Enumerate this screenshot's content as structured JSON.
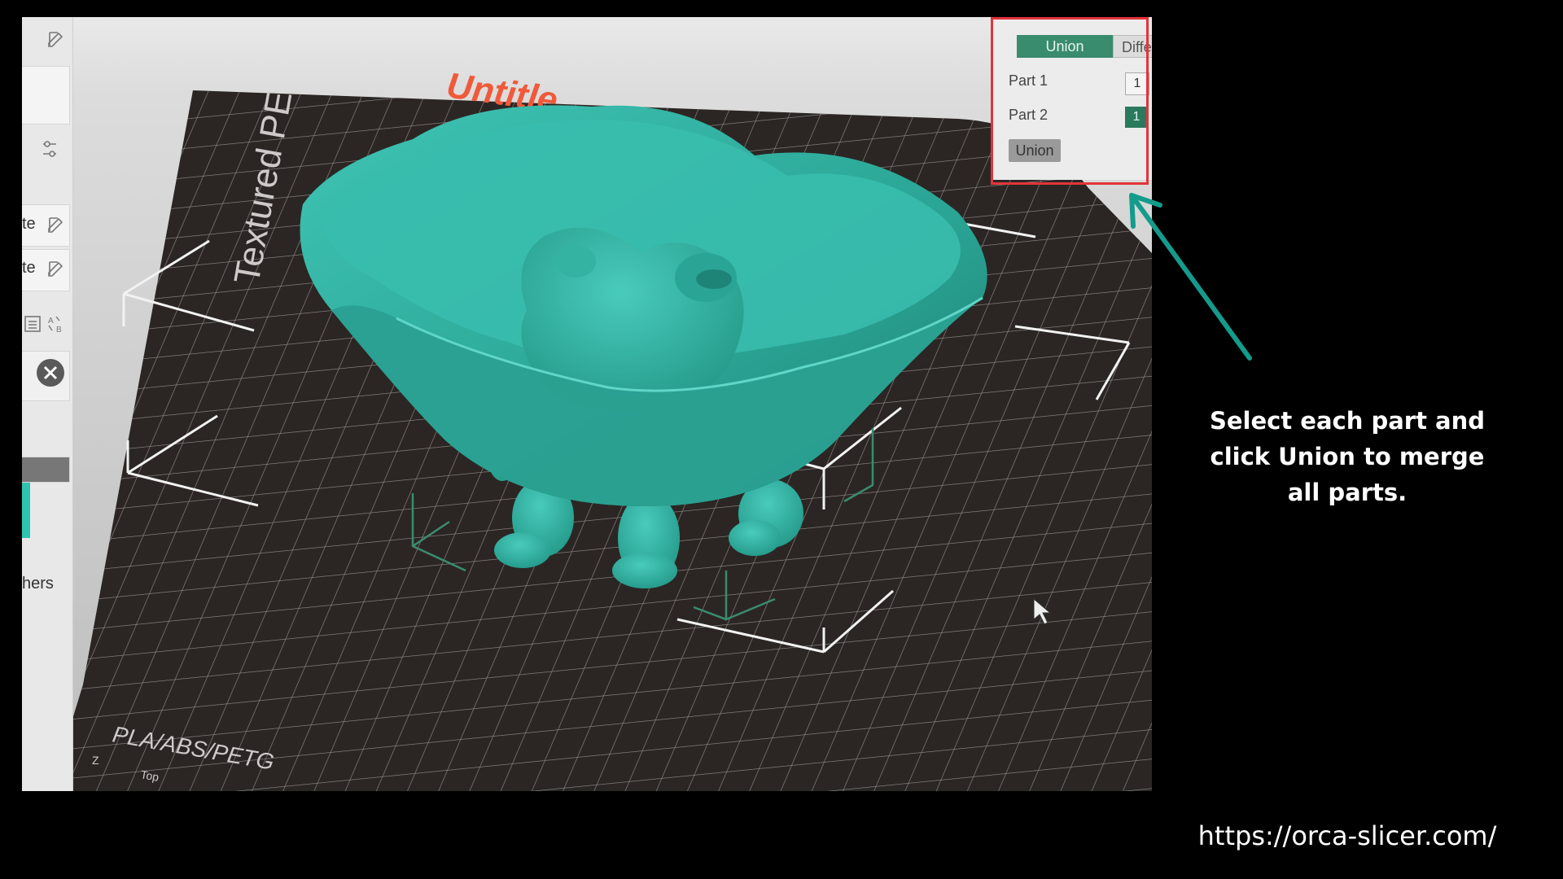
{
  "viewport": {
    "plate_title_fragment": "Untitle",
    "plate_side_text": "Textured PE",
    "plate_bottom_text": "PLA/ABS/PETG",
    "axis_label": "Z",
    "view_label": "Top"
  },
  "sidebar": {
    "items": [
      {
        "text": "te"
      },
      {
        "text": "te"
      },
      {
        "text": "hers"
      }
    ]
  },
  "boolean_panel": {
    "tabs": [
      {
        "label": "Union",
        "active": true
      },
      {
        "label": "Diffe",
        "active": false
      }
    ],
    "rows": [
      {
        "label": "Part 1",
        "value": "1"
      },
      {
        "label": "Part 2",
        "value": "1"
      }
    ],
    "action_button": "Union"
  },
  "annotation": {
    "caption": "Select each part and click Union to merge all parts.",
    "url": "https://orca-slicer.com/",
    "highlight_color": "#e3343a",
    "arrow_color": "#149b8c"
  },
  "colors": {
    "model": "#2fb5a6",
    "plate": "#2b2624",
    "accent": "#3a8c6e"
  }
}
